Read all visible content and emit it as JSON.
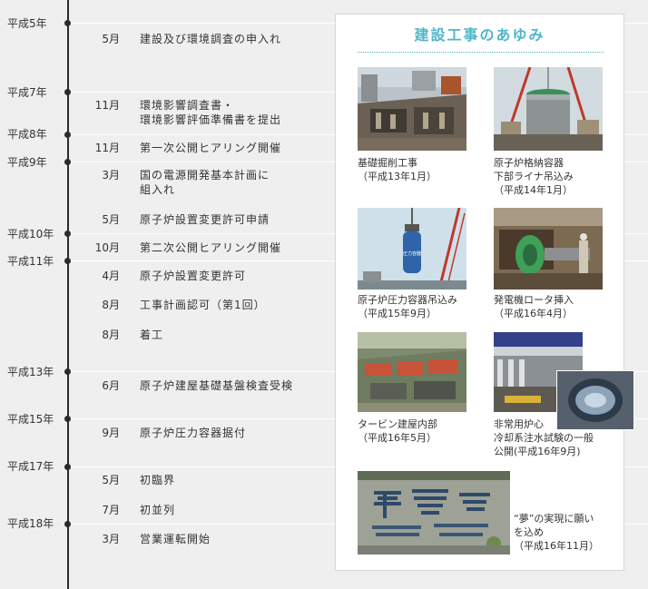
{
  "timeline": {
    "years": {
      "h5": "平成5年",
      "h7": "平成7年",
      "h8": "平成8年",
      "h9": "平成9年",
      "h10": "平成10年",
      "h11": "平成11年",
      "h13": "平成13年",
      "h15": "平成15年",
      "h17": "平成17年",
      "h18": "平成18年"
    },
    "events": [
      {
        "month": "5月",
        "text": "建設及び環境調査の申入れ"
      },
      {
        "month": "11月",
        "text": "環境影響調査書・\n環境影響評価準備書を提出"
      },
      {
        "month": "11月",
        "text": "第一次公開ヒアリング開催"
      },
      {
        "month": "3月",
        "text": "国の電源開発基本計画に\n組入れ"
      },
      {
        "month": "5月",
        "text": "原子炉設置変更許可申請"
      },
      {
        "month": "10月",
        "text": "第二次公開ヒアリング開催"
      },
      {
        "month": "4月",
        "text": "原子炉設置変更許可"
      },
      {
        "month": "8月",
        "text": "工事計画認可（第1回）"
      },
      {
        "month": "8月",
        "text": "着工"
      },
      {
        "month": "6月",
        "text": "原子炉建屋基礎基盤検査受検"
      },
      {
        "month": "9月",
        "text": "原子炉圧力容器据付"
      },
      {
        "month": "5月",
        "text": "初臨界"
      },
      {
        "month": "7月",
        "text": "初並列"
      },
      {
        "month": "3月",
        "text": "営業運転開始"
      }
    ]
  },
  "panel": {
    "title": "建設工事のあゆみ",
    "photos": [
      {
        "caption": "基礎掘削工事\n（平成13年1月）"
      },
      {
        "caption": "原子炉格納容器\n下部ライナ吊込み\n（平成14年1月）"
      },
      {
        "caption": "原子炉圧力容器吊込み\n（平成15年9月）",
        "vessel_text": "圧力容器"
      },
      {
        "caption": "発電機ロータ挿入\n（平成16年4月）"
      },
      {
        "caption": "タービン建屋内部\n（平成16年5月）"
      },
      {
        "caption": "非常用炉心\n冷却系注水試験の一般\n公開(平成16年9月)"
      },
      {
        "caption": "“夢”の実現に願い\nを込め\n（平成16年11月）"
      }
    ]
  },
  "colors": {
    "accent": "#4fb6c9",
    "line": "#2b2b2b",
    "background": "#efefef"
  }
}
